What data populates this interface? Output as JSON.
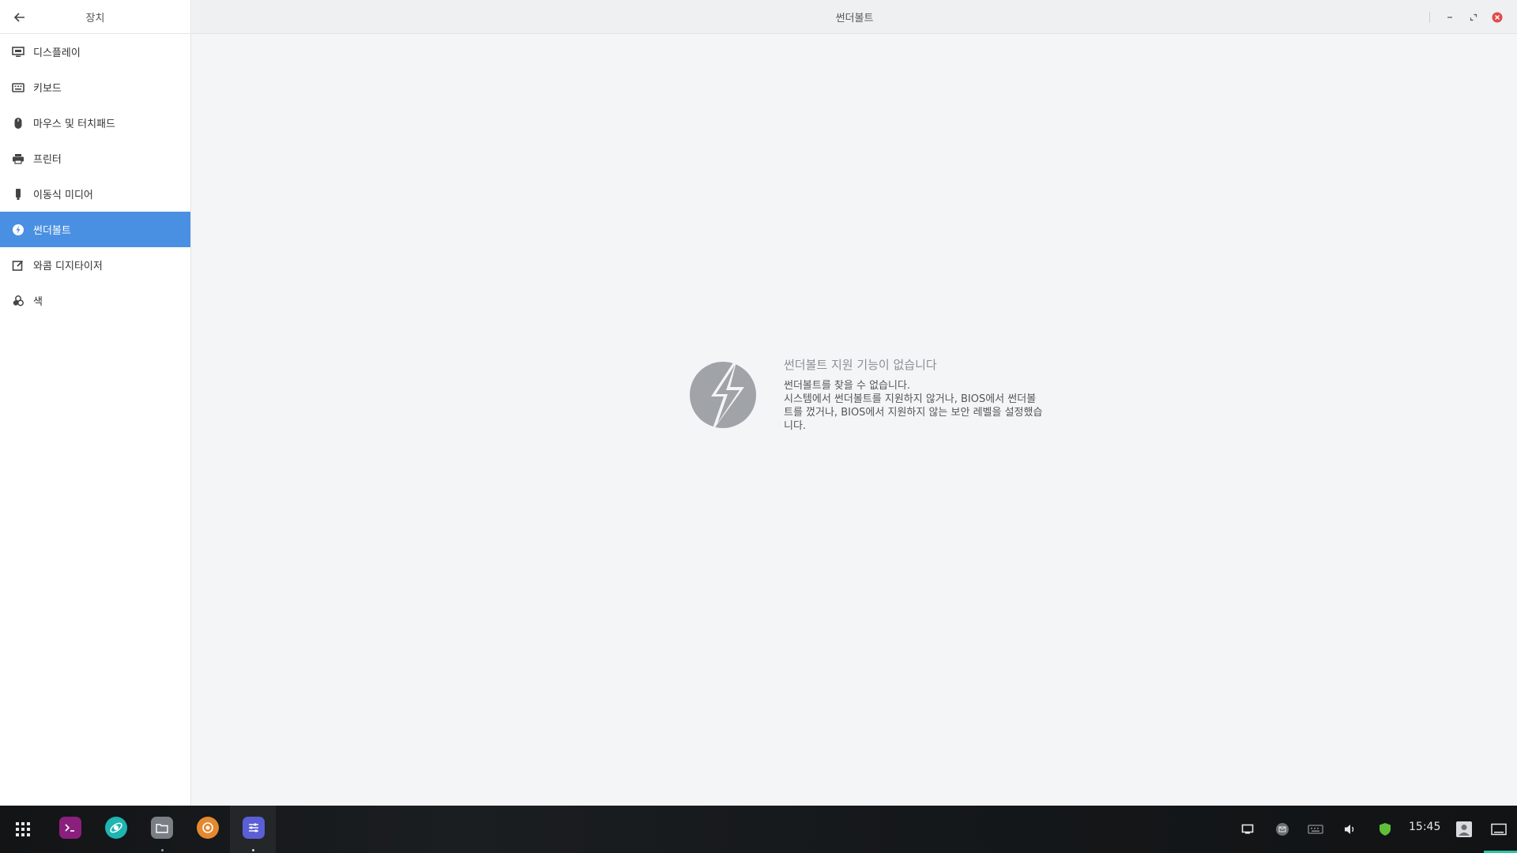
{
  "sidebar": {
    "title": "장치",
    "items": [
      {
        "label": "디스플레이",
        "icon": "display-icon"
      },
      {
        "label": "키보드",
        "icon": "keyboard-icon"
      },
      {
        "label": "마우스 및 터치패드",
        "icon": "mouse-icon"
      },
      {
        "label": "프린터",
        "icon": "printer-icon"
      },
      {
        "label": "이동식 미디어",
        "icon": "usb-drive-icon"
      },
      {
        "label": "썬더볼트",
        "icon": "thunderbolt-icon",
        "active": true
      },
      {
        "label": "와콤 디지타이저",
        "icon": "tablet-icon"
      },
      {
        "label": "색",
        "icon": "color-icon"
      }
    ]
  },
  "window": {
    "title": "썬더볼트"
  },
  "empty_state": {
    "title": "썬더볼트 지원 기능이 없습니다",
    "line1": "썬더볼트를 찾을 수 없습니다.",
    "line2": "시스템에서 썬더볼트를 지원하지 않거나, BIOS에서 썬더볼트를 껐거나, BIOS에서 지원하지 않는 보안 레벨을 설정했습니다."
  },
  "taskbar": {
    "apps": [
      "terminal-app",
      "browser-app",
      "files-app",
      "media-app",
      "settings-app"
    ],
    "clock": "15:45"
  },
  "colors": {
    "accent": "#4a90e2",
    "close": "#e24a4a",
    "taskbar_accent": "#2ec4a6"
  }
}
